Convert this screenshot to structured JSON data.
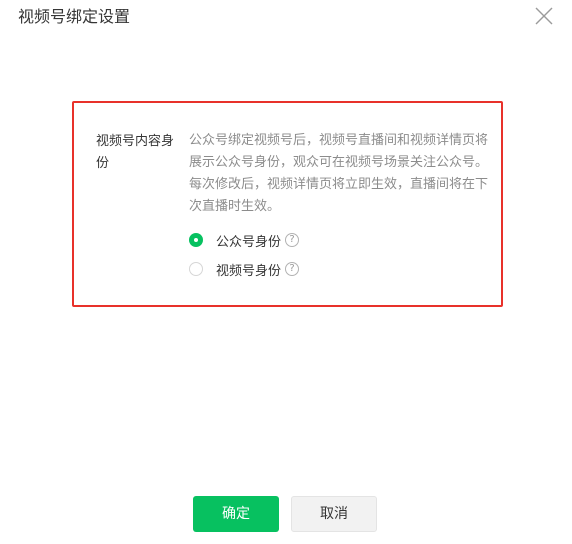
{
  "dialog": {
    "title": "视频号绑定设置",
    "close_icon": "close-icon"
  },
  "setting": {
    "label": "视频号内容身份",
    "description": "公众号绑定视频号后，视频号直播间和视频详情页将展示公众号身份，观众可在视频号场景关注公众号。每次修改后，视频详情页将立即生效，直播间将在下次直播时生效。",
    "options": [
      {
        "label": "公众号身份",
        "selected": true,
        "help_icon": "?"
      },
      {
        "label": "视频号身份",
        "selected": false,
        "help_icon": "?"
      }
    ]
  },
  "buttons": {
    "confirm": "确定",
    "cancel": "取消"
  },
  "colors": {
    "accent": "#07c160",
    "highlight_border": "#e8312a",
    "description_text": "#8c8c8c"
  }
}
